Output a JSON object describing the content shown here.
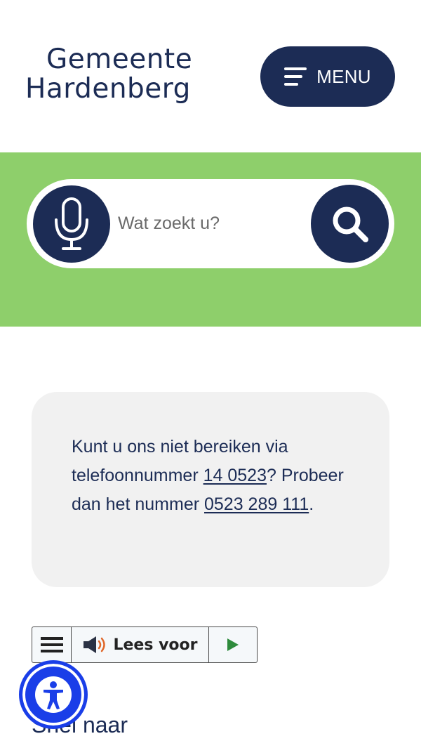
{
  "header": {
    "logo_line1": "Gemeente",
    "logo_line2": "Hardenberg",
    "menu_label": "MENU",
    "menu_icon": "hamburger-icon"
  },
  "search": {
    "placeholder": "Wat zoekt u?",
    "mic_icon": "microphone-icon",
    "search_icon": "magnifier-icon"
  },
  "notice": {
    "text1": "Kunt u ons niet bereiken via telefoonnummer ",
    "phone1": "14 0523",
    "text2": "? Probeer dan het nummer ",
    "phone2": "0523 289 111",
    "text3": "."
  },
  "readspeaker": {
    "menu_icon": "hamburger-icon",
    "speaker_icon": "speaker-icon",
    "listen_label": "Lees voor",
    "play_icon": "play-icon"
  },
  "quick_links": {
    "heading": "Snel naar"
  },
  "accessibility": {
    "icon": "accessibility-person-icon"
  },
  "colors": {
    "brand_navy": "#1c2c55",
    "brand_green": "#8ecf6b",
    "accessibility_blue": "#1a3ee8"
  }
}
